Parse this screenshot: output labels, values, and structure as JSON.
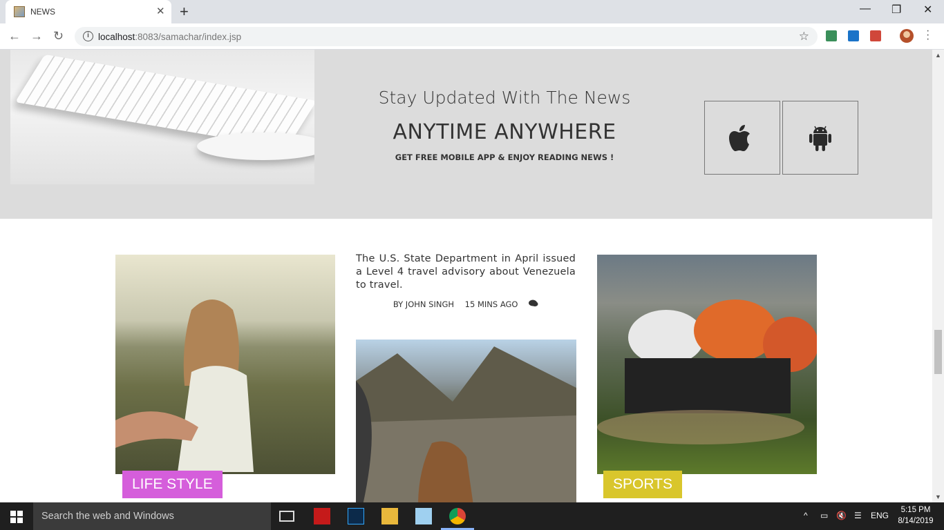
{
  "browser": {
    "tab_title": "NEWS",
    "tab_close": "✕",
    "new_tab": "+",
    "url_host": "localhost",
    "url_rest": ":8083/samachar/index.jsp",
    "window_min": "—",
    "window_restore": "❐",
    "window_close": "✕"
  },
  "banner": {
    "headline": "Stay Updated With The News",
    "big": "ANYTIME ANYWHERE",
    "sub": "GET FREE MOBILE APP & ENJOY READING NEWS !",
    "buttons": [
      {
        "icon": "apple-icon"
      },
      {
        "icon": "android-icon"
      }
    ]
  },
  "articles": {
    "lifestyle_tag": "LIFE STYLE",
    "sports_tag": "SPORTS",
    "featured_text": "The U.S. State Department in April issued a Level 4 travel advisory about Venezuela to travel.",
    "author": "BY JOHN SINGH",
    "time": "15 MINS AGO"
  },
  "taskbar": {
    "search_placeholder": "Search the web and Windows",
    "language": "ENG",
    "time": "5:15 PM",
    "date": "8/14/2019"
  },
  "colors": {
    "banner_bg": "#dcdcdc",
    "lifestyle_tag": "#d55edb",
    "sports_tag": "#d9c62c"
  }
}
